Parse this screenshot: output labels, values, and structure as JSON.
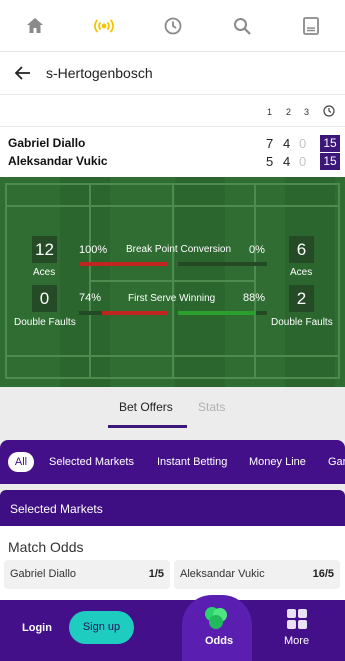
{
  "topnav": {
    "icons": [
      "home-icon",
      "live-icon",
      "clock-icon",
      "search-icon",
      "betslip-icon"
    ],
    "active_color": "#f5c400",
    "icon_color": "#8a8a8a"
  },
  "header": {
    "title": "s-Hertogenbosch"
  },
  "score_columns": [
    "1",
    "2",
    "3"
  ],
  "players": [
    {
      "name": "Gabriel Diallo",
      "sets": [
        "7",
        "4",
        "0"
      ],
      "game": "15"
    },
    {
      "name": "Aleksandar Vukic",
      "sets": [
        "5",
        "4",
        "0"
      ],
      "game": "15"
    }
  ],
  "stats": {
    "aces": {
      "label": "Aces",
      "p1": "12",
      "p2": "6"
    },
    "double_faults": {
      "label": "Double Faults",
      "p1": "0",
      "p2": "2"
    },
    "break_point": {
      "label": "Break Point Conversion",
      "p1": "100%",
      "p2": "0%",
      "p1_fill": 1.0,
      "p2_fill": 0.0
    },
    "first_serve": {
      "label": "First Serve Winning",
      "p1": "74%",
      "p2": "88%",
      "p1_fill": 0.74,
      "p2_fill": 0.88
    }
  },
  "tabs": {
    "bet_offers": "Bet Offers",
    "stats": "Stats"
  },
  "filters": {
    "all": "All",
    "items": [
      "Selected Markets",
      "Instant Betting",
      "Money Line",
      "Gar"
    ]
  },
  "selected_markets": {
    "title": "Selected Markets"
  },
  "market": {
    "title": "Match Odds",
    "options": [
      {
        "name": "Gabriel Diallo",
        "odds": "1/5"
      },
      {
        "name": "Aleksandar Vukic",
        "odds": "16/5"
      }
    ]
  },
  "bottom": {
    "login": "Login",
    "signup": "Sign up",
    "odds": "Odds",
    "more": "More"
  },
  "colors": {
    "brand": "#44108a",
    "accent": "#1ecdc0",
    "court": "#2f6d32"
  }
}
